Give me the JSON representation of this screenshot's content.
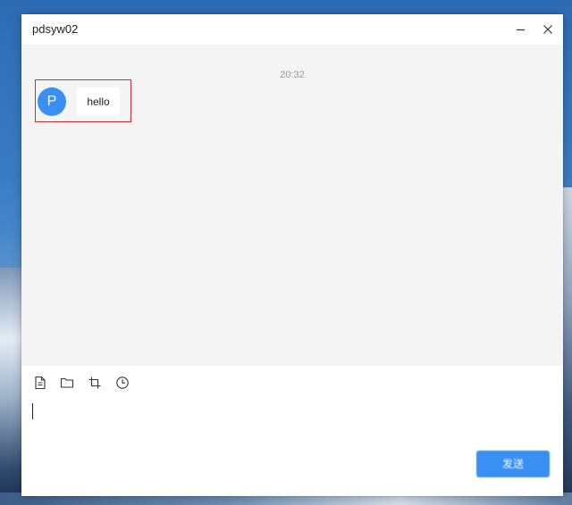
{
  "window": {
    "title": "pdsyw02"
  },
  "chat": {
    "timestamp": "20:32",
    "messages": [
      {
        "avatar_initial": "P",
        "text": "hello"
      }
    ]
  },
  "toolbar": {
    "icons": [
      "file-icon",
      "folder-icon",
      "crop-icon",
      "clock-icon"
    ]
  },
  "composer": {
    "value": ""
  },
  "send_button": {
    "label": "发送"
  },
  "colors": {
    "accent": "#3a8ff2",
    "chat_background": "#f4f4f4",
    "highlight_border": "#d9272e"
  }
}
